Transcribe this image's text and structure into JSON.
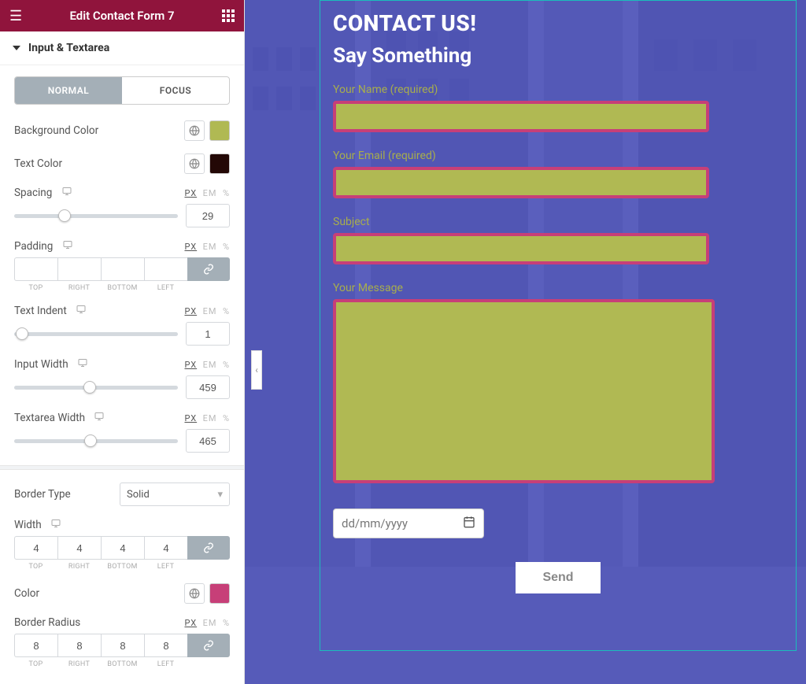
{
  "header": {
    "title": "Edit Contact Form 7"
  },
  "section": {
    "title": "Input & Textarea"
  },
  "tabs": {
    "normal": "NORMAL",
    "focus": "FOCUS"
  },
  "units": {
    "px": "PX",
    "em": "EM",
    "pct": "%"
  },
  "labels": {
    "bg_color": "Background Color",
    "text_color": "Text Color",
    "spacing": "Spacing",
    "padding": "Padding",
    "text_indent": "Text Indent",
    "input_width": "Input Width",
    "textarea_width": "Textarea Width",
    "border_type": "Border Type",
    "width": "Width",
    "color": "Color",
    "border_radius": "Border Radius"
  },
  "colors": {
    "background": "#b0b953",
    "text": "#230806",
    "border": "#c73f78"
  },
  "values": {
    "spacing": "29",
    "text_indent": "1",
    "input_width": "459",
    "textarea_width": "465",
    "border_type": "Solid",
    "border_width": {
      "top": "4",
      "right": "4",
      "bottom": "4",
      "left": "4"
    },
    "border_radius": {
      "top": "8",
      "right": "8",
      "bottom": "8",
      "left": "8"
    }
  },
  "dim_labels": {
    "top": "TOP",
    "right": "RIGHT",
    "bottom": "BOTTOM",
    "left": "LEFT"
  },
  "form": {
    "title": "CONTACT US!",
    "subtitle": "Say Something",
    "name_label": "Your Name (required)",
    "email_label": "Your Email (required)",
    "subject_label": "Subject",
    "message_label": "Your Message",
    "date_placeholder": "dd/mm/yyyy",
    "submit": "Send"
  }
}
